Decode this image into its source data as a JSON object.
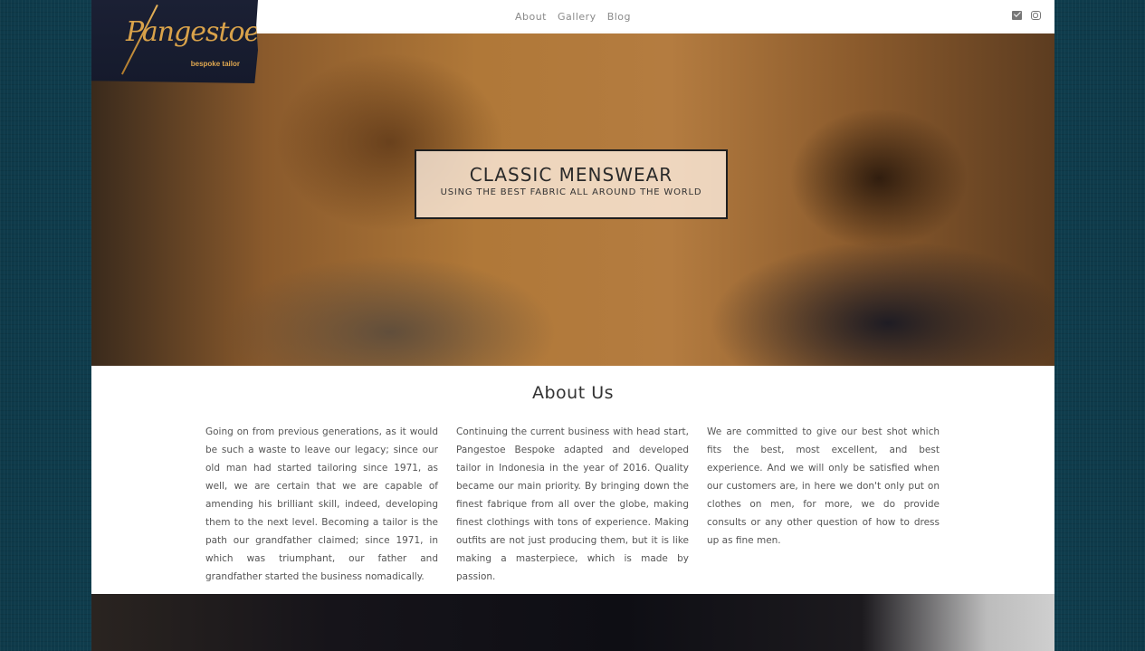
{
  "nav": {
    "items": [
      "About",
      "Gallery",
      "Blog"
    ]
  },
  "social": {
    "icons": [
      "envelope-icon",
      "instagram-icon"
    ]
  },
  "logo": {
    "script": "Pangestoe",
    "subtitle": "bespoke tailor"
  },
  "hero": {
    "title": "CLASSIC MENSWEAR",
    "subtitle": "USING THE BEST FABRIC ALL AROUND THE WORLD"
  },
  "about": {
    "title": "About Us",
    "columns": [
      "Going on from previous generations, as it would be such a waste to leave our legacy; since our old man had started tailoring since 1971, as well, we are certain that we are capable of amending his brilliant skill, indeed, developing them to the next level. Becoming a tailor is the path our grandfather claimed; since 1971, in which was triumphant, our father and grandfather started the business nomadically.",
      "Continuing the current business with head start, Pangestoe Bespoke adapted and developed tailor in Indonesia in the year of 2016. Quality became our main priority. By bringing down the finest fabrique from all over the globe, making finest clothings with tons of experience. Making outfits are not just producing them, but it is like making a masterpiece, which is made by passion.",
      "We are committed to give our best shot which fits the best, most excellent, and best experience. And we will only be satisfied when our customers are, in here we don't only put on clothes on men, for more, we do provide consults or any other question of how to dress up as fine men."
    ]
  }
}
